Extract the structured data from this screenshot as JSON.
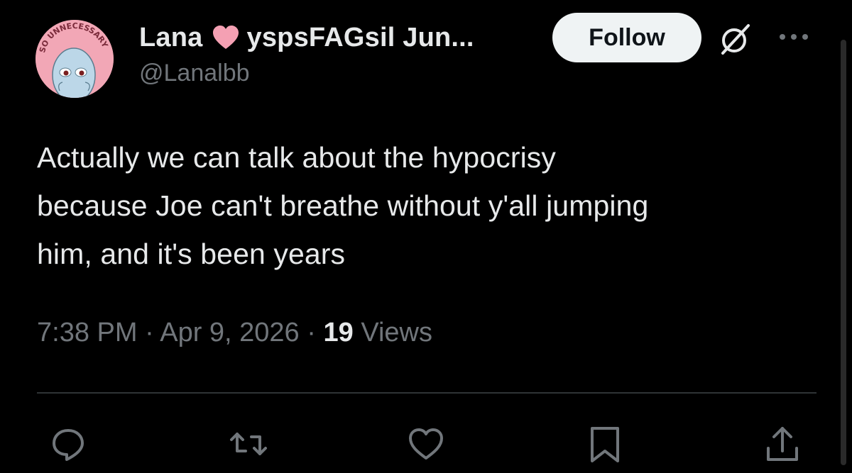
{
  "author": {
    "display_name": "Lana",
    "display_name_suffix": "yspsFAGsil Jun...",
    "handle": "@Lanalbb",
    "avatar_text": "SO UNNECESSARY",
    "heart_color": "#f4a0b3"
  },
  "follow_button": {
    "label": "Follow"
  },
  "tweet": {
    "lines": [
      "Actually we can talk about the hypocrisy",
      "because Joe can't breathe without y'all jumping",
      "him, and it's been years"
    ]
  },
  "meta": {
    "time": "7:38 PM",
    "separator": "·",
    "date": "Apr 9, 2026",
    "views_count": "19",
    "views_label": "Views"
  },
  "actions": [
    {
      "icon": "reply-icon"
    },
    {
      "icon": "retweet-icon"
    },
    {
      "icon": "like-icon"
    },
    {
      "icon": "bookmark-icon"
    },
    {
      "icon": "share-icon"
    }
  ],
  "colors": {
    "background": "#000000",
    "text_primary": "#e7e9ea",
    "text_secondary": "#71767b",
    "divider": "#2f3336",
    "follow_bg": "#eff3f4"
  }
}
